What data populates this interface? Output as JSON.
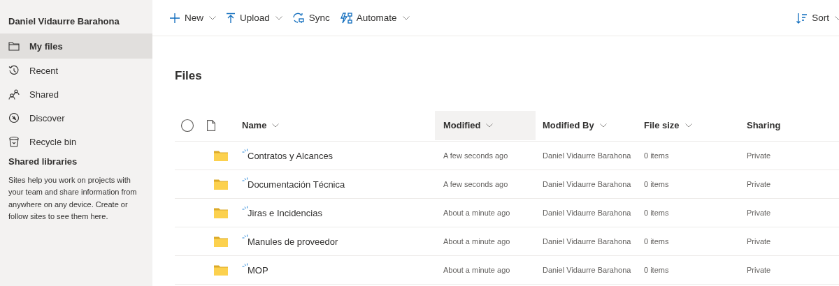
{
  "sidebar": {
    "user_name": "Daniel Vidaurre Barahona",
    "nav": [
      {
        "label": "My files",
        "selected": true
      },
      {
        "label": "Recent",
        "selected": false
      },
      {
        "label": "Shared",
        "selected": false
      },
      {
        "label": "Discover",
        "selected": false
      },
      {
        "label": "Recycle bin",
        "selected": false
      }
    ],
    "section_title": "Shared libraries",
    "description": "Sites help you work on projects with your team and share information from anywhere on any device. Create or follow sites to see them here."
  },
  "toolbar": {
    "items": [
      {
        "label": "New",
        "has_menu": true
      },
      {
        "label": "Upload",
        "has_menu": true
      },
      {
        "label": "Sync",
        "has_menu": false
      },
      {
        "label": "Automate",
        "has_menu": true
      }
    ],
    "sort": {
      "label": "Sort",
      "has_menu": true
    }
  },
  "title": "Files",
  "table": {
    "columns": [
      {
        "label": "Name",
        "has_menu": true,
        "selected": false
      },
      {
        "label": "Modified",
        "has_menu": true,
        "selected": true
      },
      {
        "label": "Modified By",
        "has_menu": true,
        "selected": false
      },
      {
        "label": "File size",
        "has_menu": true,
        "selected": false
      },
      {
        "label": "Sharing",
        "has_menu": false,
        "selected": false
      }
    ],
    "rows": [
      {
        "kind": "folder",
        "new": true,
        "name": "Contratos y Alcances",
        "modified": "A few seconds ago",
        "modified_by": "Daniel Vidaurre Barahona",
        "file_size": "0 items",
        "sharing": "Private"
      },
      {
        "kind": "folder",
        "new": true,
        "name": "Documentación Técnica",
        "modified": "A few seconds ago",
        "modified_by": "Daniel Vidaurre Barahona",
        "file_size": "0 items",
        "sharing": "Private"
      },
      {
        "kind": "folder",
        "new": true,
        "name": "Jiras e Incidencias",
        "modified": "About a minute ago",
        "modified_by": "Daniel Vidaurre Barahona",
        "file_size": "0 items",
        "sharing": "Private"
      },
      {
        "kind": "folder",
        "new": true,
        "name": "Manules de proveedor",
        "modified": "About a minute ago",
        "modified_by": "Daniel Vidaurre Barahona",
        "file_size": "0 items",
        "sharing": "Private"
      },
      {
        "kind": "folder",
        "new": true,
        "name": "MOP",
        "modified": "About a minute ago",
        "modified_by": "Daniel Vidaurre Barahona",
        "file_size": "0 items",
        "sharing": "Private"
      }
    ]
  }
}
